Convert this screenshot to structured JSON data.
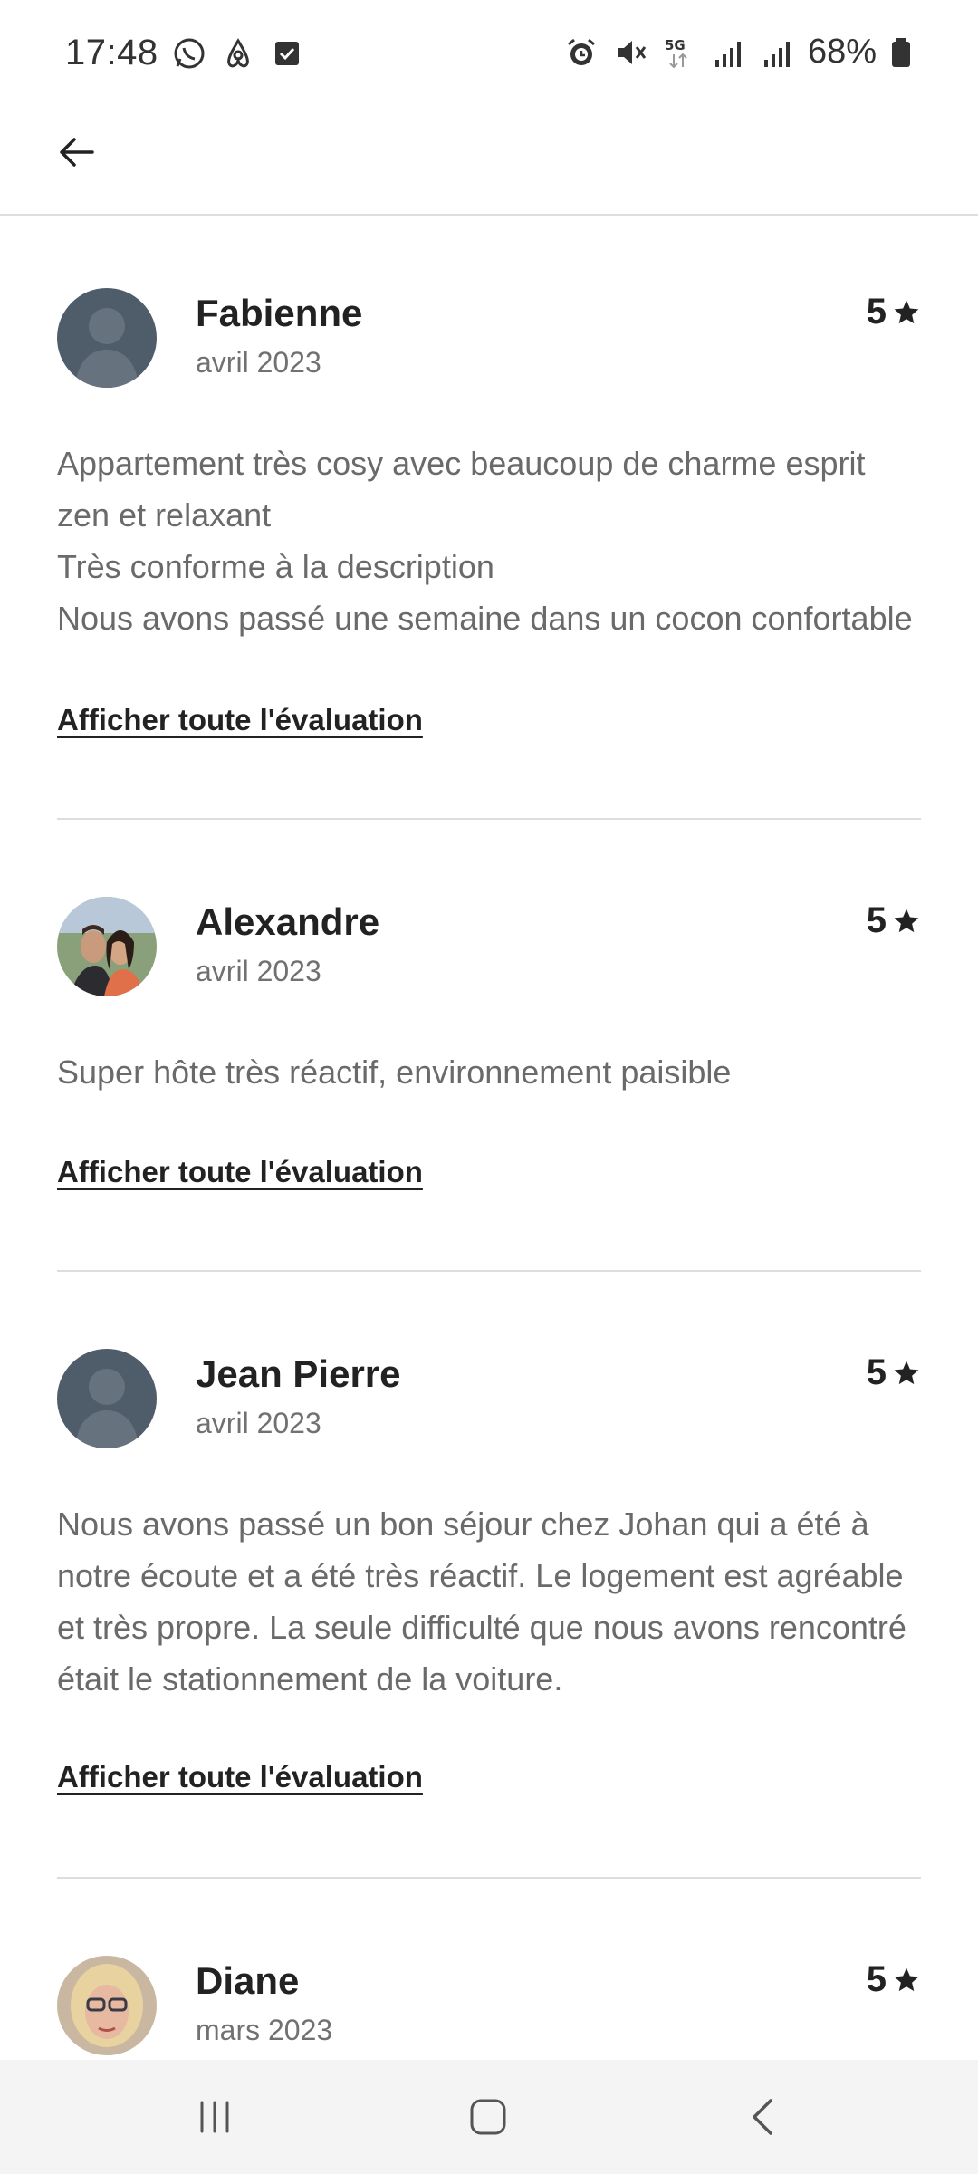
{
  "status_bar": {
    "time": "17:48",
    "left_icons": [
      "whatsapp-icon",
      "airbnb-icon",
      "checkbox-app-icon"
    ],
    "right_icons": [
      "alarm-icon",
      "mute-icon",
      "5g-icon",
      "signal-icon",
      "signal-icon"
    ],
    "battery": "68%"
  },
  "header": {
    "back_icon": "arrow-left-icon"
  },
  "reviews": [
    {
      "name": "Fabienne",
      "date": "avril 2023",
      "rating": "5",
      "avatar": "default-avatar",
      "text": "Appartement très cosy avec beaucoup de charme esprit zen et relaxant\nTrès conforme à la description\nNous avons passé une semaine dans un cocon confortable",
      "link": "Afficher toute l'évaluation"
    },
    {
      "name": "Alexandre",
      "date": "avril 2023",
      "rating": "5",
      "avatar": "photo-avatar",
      "text": "Super hôte très réactif, environnement paisible",
      "link": "Afficher toute l'évaluation"
    },
    {
      "name": "Jean Pierre",
      "date": "avril 2023",
      "rating": "5",
      "avatar": "default-avatar",
      "text": "Nous avons passé un bon séjour chez Johan qui a été à notre écoute et a été très réactif. Le logement est agréable et très propre. La seule difficulté que nous avons rencontré était le stationnement de la voiture.",
      "link": "Afficher toute l'évaluation"
    },
    {
      "name": "Diane",
      "date": "mars 2023",
      "rating": "5",
      "avatar": "photo-avatar"
    }
  ],
  "colors": {
    "text_primary": "#222222",
    "text_secondary": "#717171",
    "divider": "#dddddd",
    "default_avatar": "#4f5d6b",
    "navbar_bg": "#f4f4f4"
  },
  "nav_bar": {
    "icons": [
      "recent-apps-icon",
      "home-icon",
      "back-icon"
    ]
  }
}
